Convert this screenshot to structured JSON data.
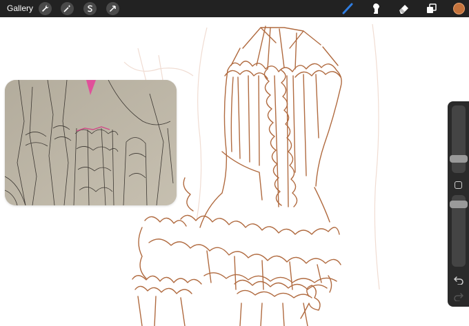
{
  "topbar": {
    "gallery_label": "Gallery",
    "left_tools": [
      "wrench-icon",
      "magic-wand-icon",
      "selection-icon",
      "transform-icon"
    ],
    "right_tools": [
      "brush-icon",
      "smudge-icon",
      "eraser-icon",
      "layers-icon"
    ],
    "color": "#c4733c"
  },
  "canvas": {
    "sketch_color": "#b06a3f",
    "reference_window": "reference-photo"
  },
  "sidebar": {
    "brush_size": 0.5,
    "opacity": 0.9
  }
}
